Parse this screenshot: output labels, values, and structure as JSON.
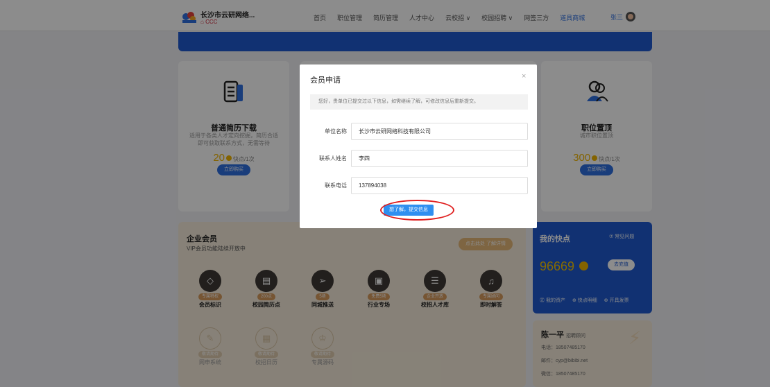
{
  "header": {
    "company": "长沙市云研网络...",
    "company_sub": "CCC",
    "nav": [
      "首页",
      "职位管理",
      "简历管理",
      "人才中心",
      "云校招 ∨",
      "校园招聘 ∨",
      "网签三方",
      "道具商城"
    ],
    "active_nav": "道具商城",
    "user": "张三"
  },
  "cards": {
    "left": {
      "title": "普通简历下载",
      "desc": "适用于各类人才定向挖掘，简历合适即可获取联系方式，无需等待",
      "price": "20",
      "unit": "快点/1次",
      "button": "立即购买"
    },
    "right": {
      "title": "职位置顶",
      "desc": "城市职位置顶",
      "price": "300",
      "unit": "快点/1次",
      "button": "立即购买"
    }
  },
  "vip": {
    "title": "企业会员",
    "subtitle": "VIP会员功能陆续开放中",
    "cta": "点击此处 了解详情",
    "perks": [
      {
        "tag": "专属特权",
        "name": "会员标识",
        "icon": "diamond-icon"
      },
      {
        "tag": "200点",
        "name": "校园简历点",
        "icon": "document-icon"
      },
      {
        "tag": "5场",
        "name": "同城推送",
        "icon": "send-icon"
      },
      {
        "tag": "免费5场",
        "name": "行业专场",
        "icon": "briefcase-icon"
      },
      {
        "tag": "企业开放",
        "name": "校招人才库",
        "icon": "file-cabinet-icon"
      },
      {
        "tag": "专属顾问",
        "name": "即时解答",
        "icon": "headset-icon"
      }
    ],
    "perks_soon": [
      {
        "tag": "敬请期待",
        "name": "网申系统",
        "icon": "form-icon"
      },
      {
        "tag": "敬请期待",
        "name": "校招日历",
        "icon": "calendar-icon"
      },
      {
        "tag": "敬请期待",
        "name": "专属源码",
        "icon": "crown-icon"
      }
    ]
  },
  "kuaidian": {
    "title": "我的快点",
    "faq": "⑦ 常见问题",
    "balance": "96669",
    "recharge": "去充值",
    "links": [
      "㊣ 我的资产",
      "⊕ 快点明细",
      "⊕ 开具发票"
    ]
  },
  "contact": {
    "name": "陈一平",
    "role": "招聘顾问",
    "phone": "电话：18507485170",
    "email": "邮件：cyp@bibibi.net",
    "wechat": "微信：18507485170"
  },
  "modal": {
    "title": "会员申请",
    "close": "×",
    "notice": "您好，贵单位已提交过以下信息，如需继续了解，可修改信息后重新提交。",
    "fields": [
      {
        "label": "单位名称",
        "value": "长沙市云研网络科技有限公司"
      },
      {
        "label": "联系人姓名",
        "value": "李四"
      },
      {
        "label": "联系电话",
        "value": "137894038"
      }
    ],
    "submit": "想了解，提交信息"
  },
  "colors": {
    "brand_blue": "#1f5ad0",
    "gold": "#f0b400",
    "highlight_red": "#e02020"
  }
}
